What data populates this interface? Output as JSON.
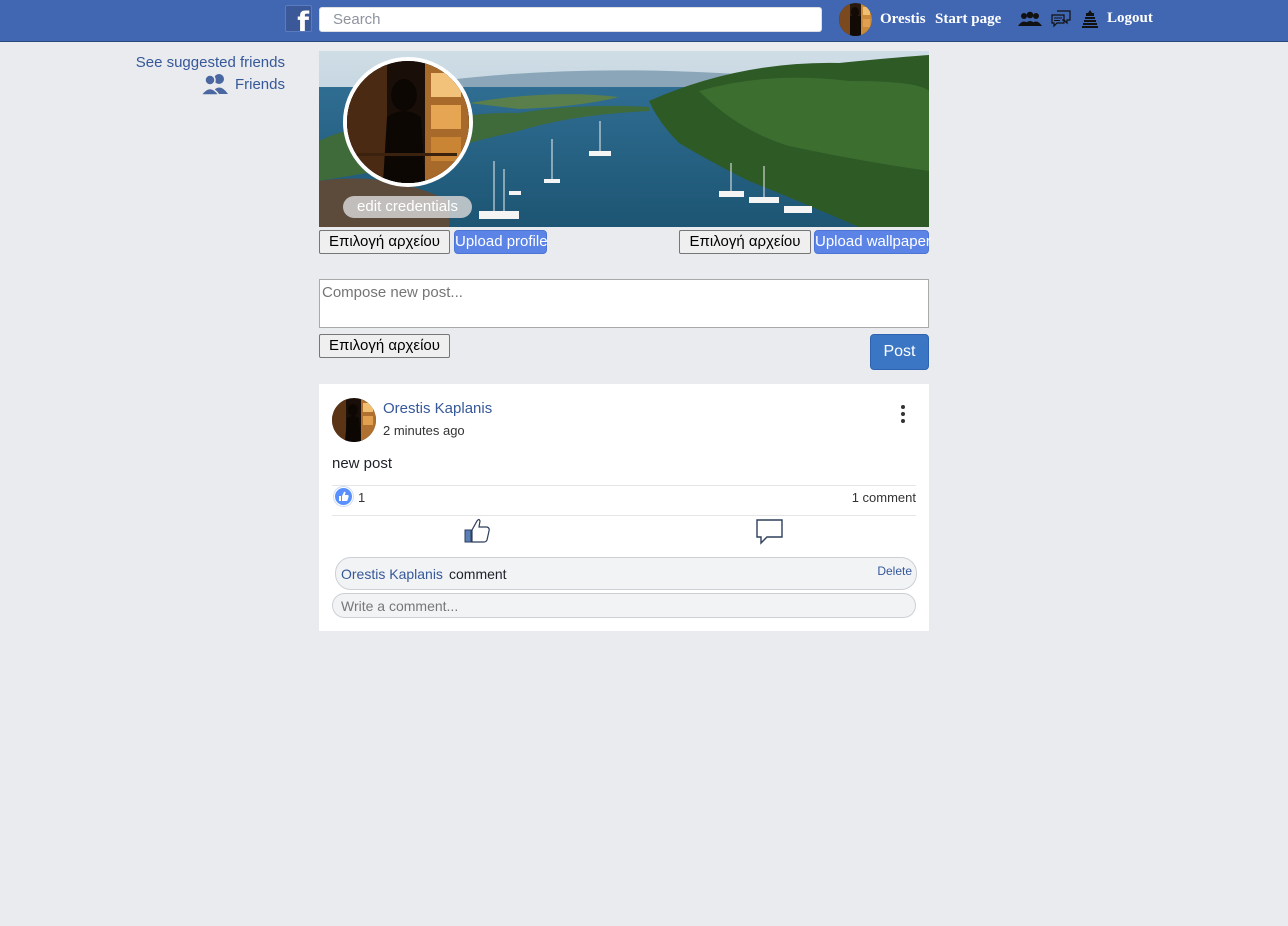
{
  "header": {
    "search_placeholder": "Search",
    "user_name": "Orestis",
    "start_page": "Start page",
    "logout": "Logout",
    "brand_color": "#4267b2",
    "icons": [
      "friends-requests-icon",
      "messages-icon",
      "notifications-icon"
    ]
  },
  "sidebar": {
    "suggested": "See suggested friends",
    "friends": "Friends"
  },
  "profile": {
    "edit_credentials": "edit credentials",
    "choose_file": "Επιλογή αρχείου",
    "upload_profile": "Upload profile",
    "upload_wallpaper": "Upload wallpaper"
  },
  "composer": {
    "placeholder": "Compose new post...",
    "choose_file": "Επιλογή αρχείου",
    "post_button": "Post"
  },
  "post": {
    "author": "Orestis Kaplanis",
    "time": "2 minutes ago",
    "text": "new post",
    "likes": "1",
    "comments_count": "1 comment",
    "comment": {
      "author": "Orestis Kaplanis",
      "text": "comment",
      "delete": "Delete"
    },
    "write_comment_placeholder": "Write a comment..."
  }
}
